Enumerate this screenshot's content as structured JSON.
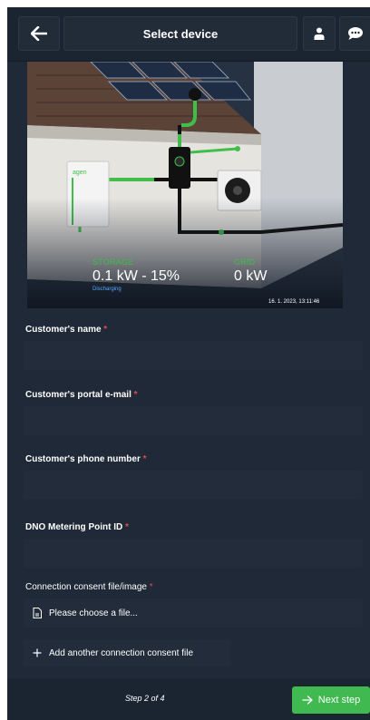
{
  "header": {
    "title": "Select device",
    "icons": {
      "back": "arrow-left-icon",
      "user": "user-icon",
      "chat": "chat-bubble-icon"
    }
  },
  "hero": {
    "device_logo": "agen",
    "storage": {
      "label": "STORAGE",
      "value": "0.1 kW - 15%",
      "status": "Discharging"
    },
    "grid": {
      "label": "GRID",
      "value": "0 kW"
    },
    "timestamp": "16. 1. 2023, 13:11:46"
  },
  "form": {
    "customer_name": {
      "label": "Customer's name",
      "required_mark": "*",
      "value": ""
    },
    "customer_email": {
      "label": "Customer's portal e-mail",
      "required_mark": "*",
      "value": ""
    },
    "customer_phone": {
      "label": "Customer's phone number",
      "required_mark": "*",
      "value": ""
    },
    "dno_id": {
      "label": "DNO Metering Point ID",
      "required_mark": "*",
      "value": ""
    },
    "consent_file": {
      "label": "Connection consent file/image",
      "required_mark": "*",
      "placeholder": "Please choose a file...",
      "add_label": "Add another connection consent file"
    }
  },
  "footer": {
    "step": "Step 2 of 4",
    "next_label": "Next step"
  },
  "colors": {
    "accent": "#3fb950",
    "required": "#e5484d",
    "background": "#1f2937"
  }
}
